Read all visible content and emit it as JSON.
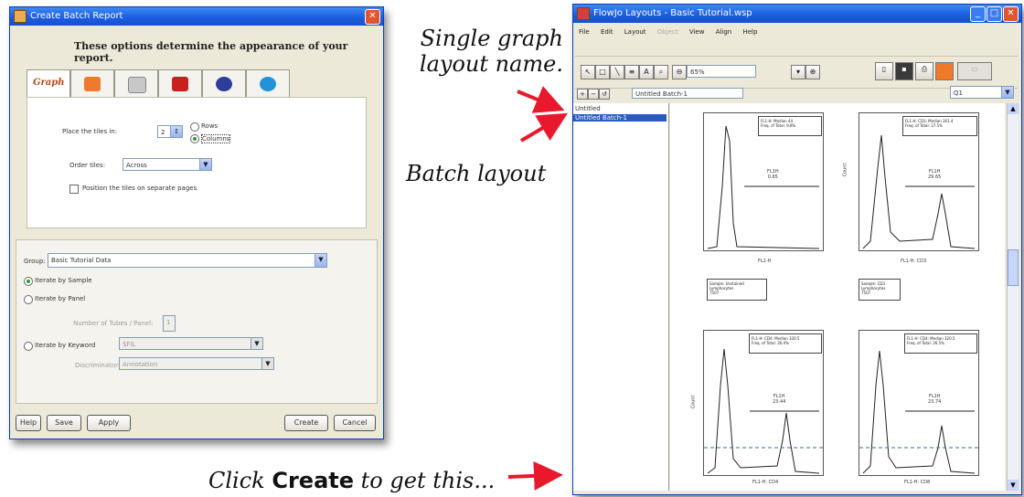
{
  "dialog": {
    "title": "Create Batch Report",
    "header": "These options determine the appearance of your report.",
    "tabs": [
      {
        "label": "Graph",
        "icon": "graph-tab-icon"
      },
      {
        "label": "",
        "icon": "image-tab-icon"
      },
      {
        "label": "",
        "icon": "printer-tab-icon"
      },
      {
        "label": "",
        "icon": "pdf-tab-icon"
      },
      {
        "label": "",
        "icon": "web-tab-icon"
      },
      {
        "label": "",
        "icon": "info-tab-icon"
      }
    ],
    "place_tiles_label": "Place the tiles in:",
    "place_tiles_value": "2",
    "rows_label": "Rows",
    "columns_label": "Columns",
    "order_tiles_label": "Order tiles:",
    "order_tiles_value": "Across",
    "separate_pages_label": "Position the tiles on separate pages",
    "group_label": "Group:",
    "group_value": "Basic Tutorial Data",
    "iterate_sample": "Iterate by Sample",
    "iterate_panel": "Iterate by Panel",
    "tubes_label": "Number of Tubes / Panel:",
    "tubes_value": "1",
    "iterate_keyword": "Iterate by Keyword",
    "keyword_value": "$FIL",
    "discriminator_label": "Discriminator:",
    "discriminator_value": "Annotation",
    "buttons": {
      "help": "Help",
      "save": "Save",
      "apply": "Apply",
      "create": "Create",
      "cancel": "Cancel"
    }
  },
  "layout_window": {
    "title": "FlowJo Layouts - Basic Tutorial.wsp",
    "menu": [
      "File",
      "Edit",
      "Layout",
      "Object",
      "View",
      "Align",
      "Help"
    ],
    "zoom": "65%",
    "layout_name_field": "Untitled Batch-1",
    "right_field": "Q1",
    "layouts": [
      "Untitled",
      "Untitled Batch-1"
    ],
    "plots": [
      {
        "title": "FL1-H: Median 44",
        "subtitle": "Freq. of Total: 9.8%",
        "gate": "FL1H",
        "gate_val": "0.65",
        "xlabel": "FL1-H",
        "ylabel": ""
      },
      {
        "title": "FL1-H: CD3: Median 301.4",
        "subtitle": "Freq. of Total: 27.5%",
        "gate": "FL1H",
        "gate_val": "29.65",
        "xlabel": "FL1-H: CD3",
        "ylabel": "Count"
      },
      {
        "title": "FL1-H: CD4: Median 320.5",
        "subtitle": "Freq. of Total: 26.4%",
        "gate": "FL1H",
        "gate_val": "23.44",
        "xlabel": "FL1-H: CD4",
        "ylabel": "Count"
      },
      {
        "title": "FL1-H: CD4: Median 320.5",
        "subtitle": "Freq. of Total: 26.5%",
        "gate": "FL1H",
        "gate_val": "23.74",
        "xlabel": "FL1-H: CD8",
        "ylabel": ""
      }
    ],
    "samples": [
      {
        "line1": "Sample: Unstained",
        "line2": "Lymphocytes",
        "line3": "7507"
      },
      {
        "line1": "Sample: CD3",
        "line2": "Lymphocytes",
        "line3": "7507"
      }
    ]
  },
  "captions": {
    "single_graph": "Single graph layout name.",
    "batch": "Batch layout",
    "click_pre": "Click",
    "click_bold": "Create",
    "click_post": "to get this..."
  },
  "colors": {
    "xp_blue": "#1c5ee0",
    "arrow_red": "#e8192c",
    "dialog_bg": "#ece9d8"
  }
}
